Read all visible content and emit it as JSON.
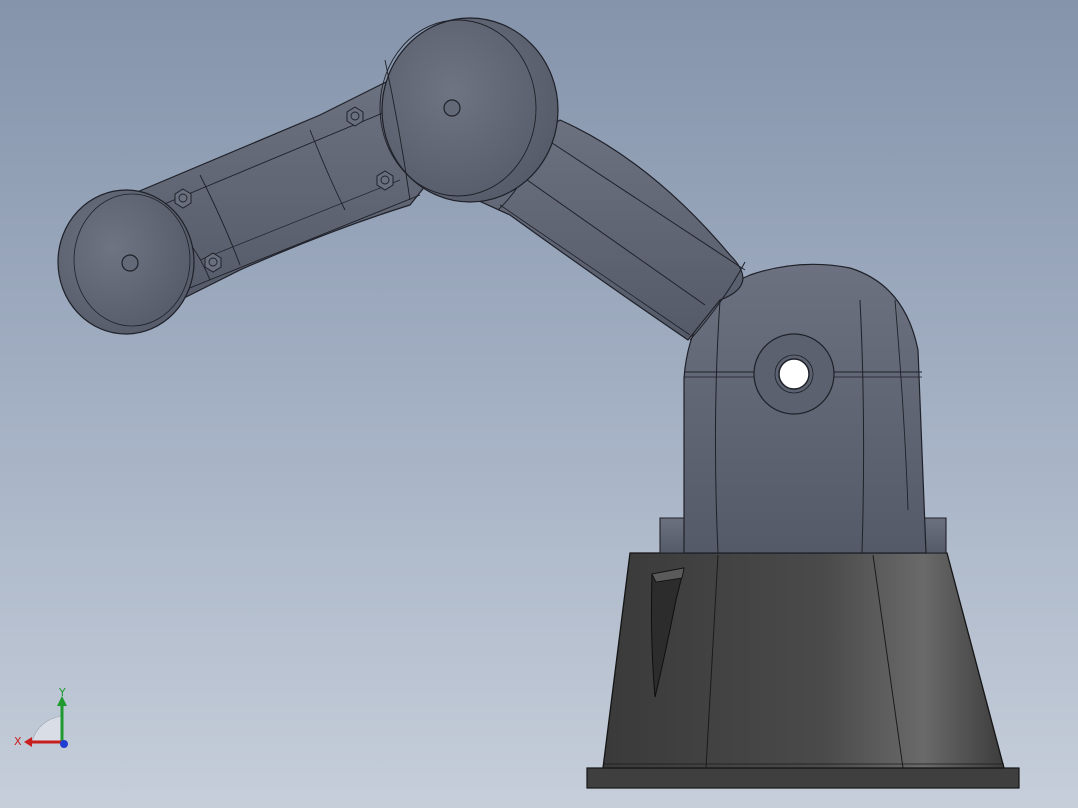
{
  "viewport": {
    "background_top": "#8594ab",
    "background_bottom": "#c6ceda"
  },
  "model": {
    "kind": "robot-arm",
    "arm_color": "#5f6472",
    "arm_edge_color": "#1f2129",
    "base_color": "#454545"
  },
  "triad": {
    "x_label": "X",
    "y_label": "Y",
    "x_color": "#c81e1e",
    "y_color": "#1f9a2e",
    "z_color": "#1f3fd0"
  }
}
